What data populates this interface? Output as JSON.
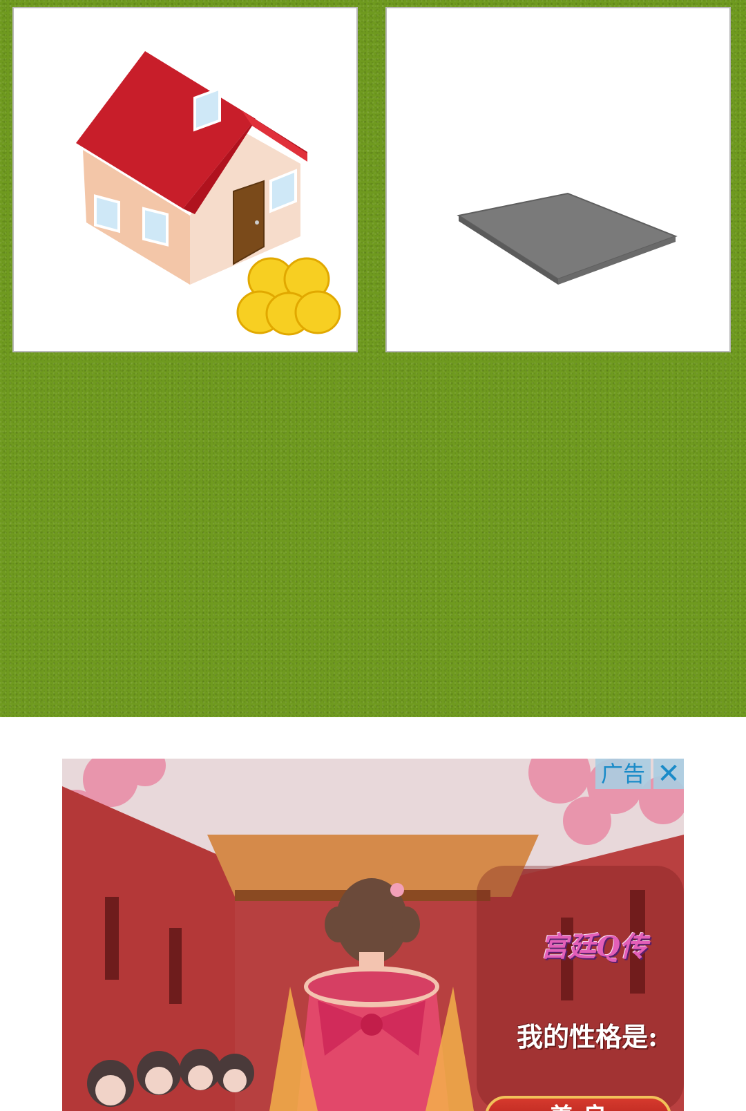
{
  "game_grid": {
    "tiles": [
      {
        "name": "house-with-coins",
        "icon": "house-icon"
      },
      {
        "name": "empty-plot",
        "icon": "empty-plot-icon"
      }
    ],
    "background_color": "#6f9a1f"
  },
  "ad": {
    "badge_label": "广告",
    "close_glyph": "✕",
    "game_logo": "宫廷Q传",
    "question": "我的性格是:",
    "option_label": "善 良"
  }
}
